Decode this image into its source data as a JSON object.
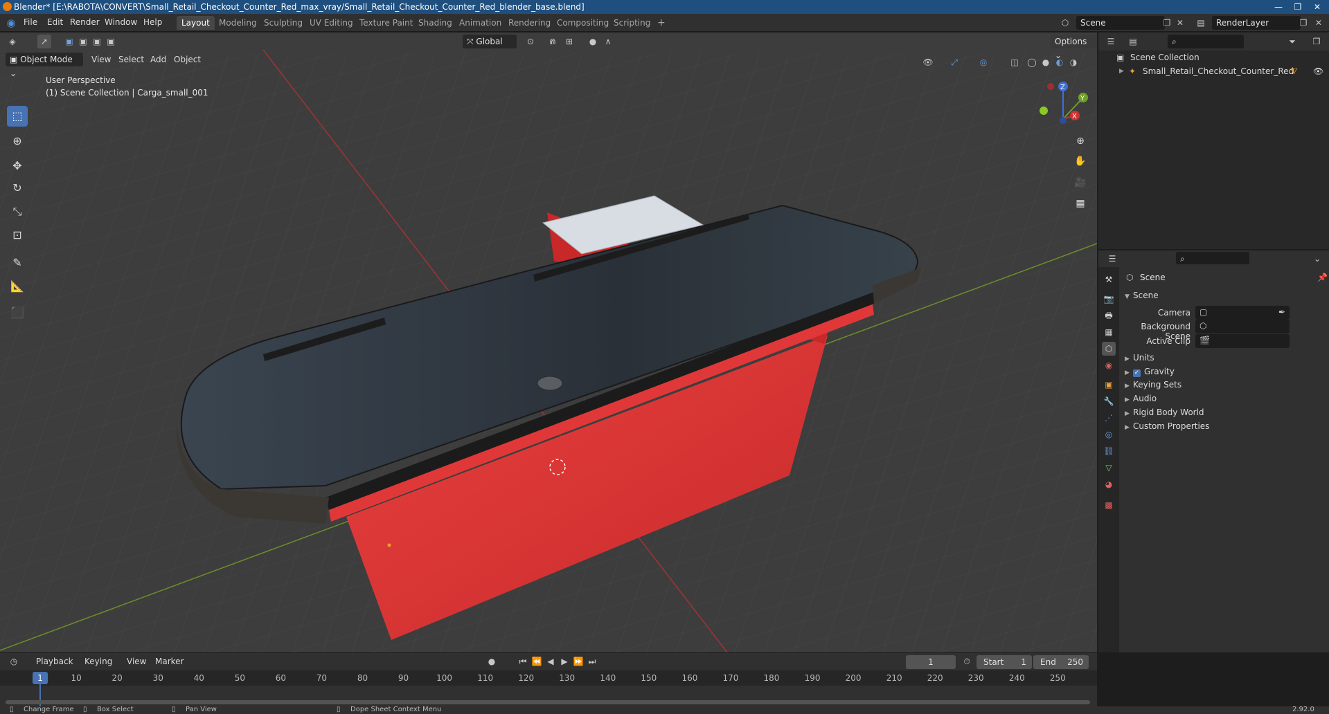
{
  "titlebar": {
    "title": "Blender* [E:\\RABOTA\\CONVERT\\Small_Retail_Checkout_Counter_Red_max_vray/Small_Retail_Checkout_Counter_Red_blender_base.blend]",
    "minimize": "—",
    "maximize": "❐",
    "close": "✕"
  },
  "menubar": {
    "menus": [
      "File",
      "Edit",
      "Render",
      "Window",
      "Help"
    ],
    "workspaces": [
      "Layout",
      "Modeling",
      "Sculpting",
      "UV Editing",
      "Texture Paint",
      "Shading",
      "Animation",
      "Rendering",
      "Compositing",
      "Scripting"
    ],
    "active_workspace": "Layout",
    "add_workspace": "+",
    "scene_name": "Scene",
    "render_layer": "RenderLayer"
  },
  "viewport": {
    "mode": "Object Mode",
    "menus": [
      "View",
      "Select",
      "Add",
      "Object"
    ],
    "transform_orientation": "Global",
    "options_label": "Options",
    "perspective_label": "User Perspective",
    "collection_label": "(1) Scene Collection | Carga_small_001",
    "gizmo_axes": {
      "z": "Z",
      "y": "Y",
      "x": "X"
    }
  },
  "outliner": {
    "root": "Scene Collection",
    "items": [
      "Small_Retail_Checkout_Counter_Red"
    ]
  },
  "properties": {
    "context_title": "Scene",
    "section_scene": "Scene",
    "fields": [
      {
        "label": "Camera",
        "value": ""
      },
      {
        "label": "Background Scene",
        "value": ""
      },
      {
        "label": "Active Clip",
        "value": ""
      }
    ],
    "panels": [
      "Units",
      "Gravity",
      "Keying Sets",
      "Audio",
      "Rigid Body World",
      "Custom Properties"
    ],
    "gravity_checked": true
  },
  "timeline": {
    "menus": [
      "Playback",
      "Keying",
      "View",
      "Marker"
    ],
    "current_frame": "1",
    "start_label": "Start",
    "start_value": "1",
    "end_label": "End",
    "end_value": "250",
    "ticks": [
      "1",
      "10",
      "20",
      "30",
      "40",
      "50",
      "60",
      "70",
      "80",
      "90",
      "100",
      "110",
      "120",
      "130",
      "140",
      "150",
      "160",
      "170",
      "180",
      "190",
      "200",
      "210",
      "220",
      "230",
      "240",
      "250"
    ]
  },
  "statusbar": {
    "items": [
      "Change Frame",
      "Box Select",
      "Pan View",
      "Dope Sheet Context Menu"
    ],
    "version": "2.92.0"
  },
  "colors": {
    "accent": "#4772b3",
    "counter_red": "#d93434",
    "counter_top": "#2b3036",
    "viewport_bg": "#3d3d3d"
  }
}
